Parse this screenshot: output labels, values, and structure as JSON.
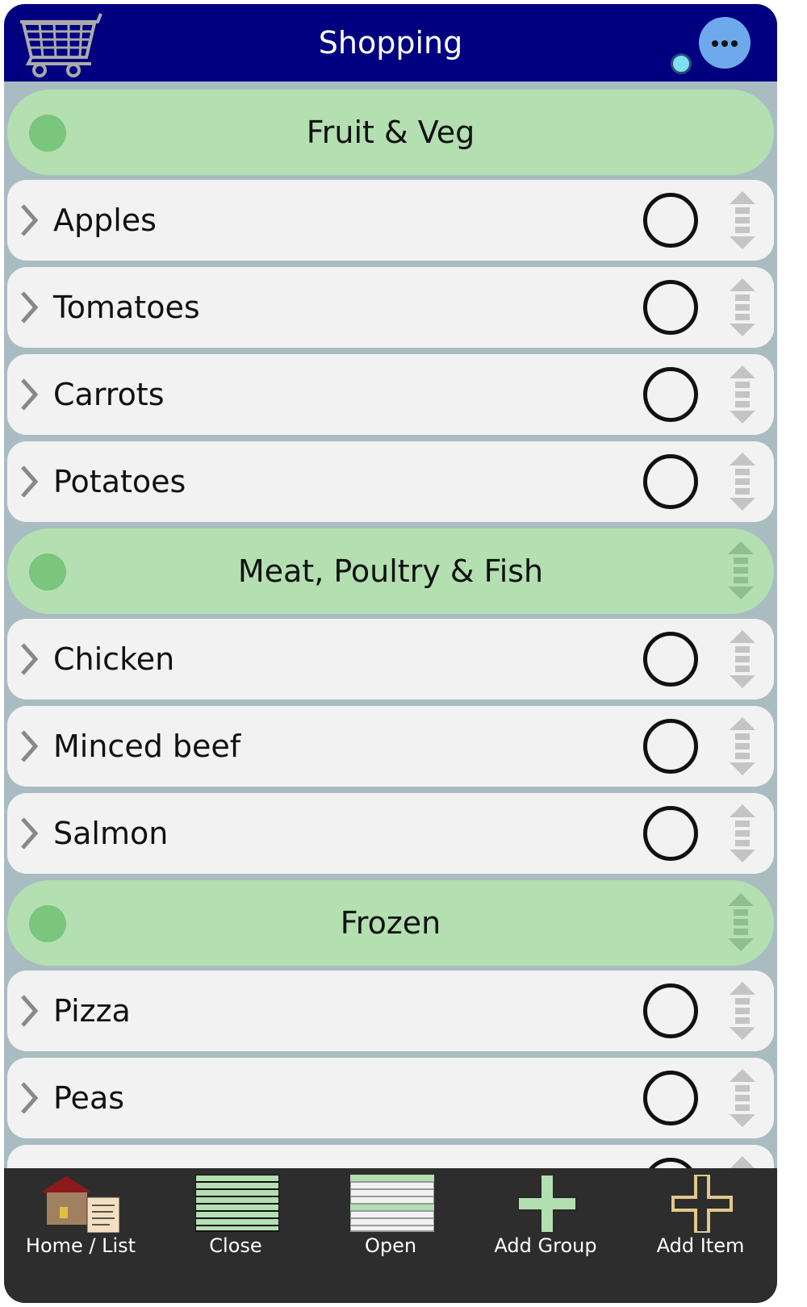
{
  "header": {
    "title": "Shopping",
    "menu_icon": "ellipsis-icon",
    "logo_icon": "shopping-cart-icon"
  },
  "groups": [
    {
      "label": "Fruit & Veg",
      "items": [
        "Apples",
        "Tomatoes",
        "Carrots",
        "Potatoes"
      ]
    },
    {
      "label": "Meat, Poultry & Fish",
      "items": [
        "Chicken",
        "Minced beef",
        "Salmon"
      ]
    },
    {
      "label": "Frozen",
      "items": [
        "Pizza",
        "Peas"
      ]
    }
  ],
  "toolbar": {
    "home_label": "Home / List",
    "close_label": "Close",
    "open_label": "Open",
    "add_group_label": "Add Group",
    "add_item_label": "Add Item"
  },
  "colors": {
    "header_bg": "#000080",
    "group_bg": "#b3dfb1",
    "item_bg": "#f2f2f2",
    "toolbar_bg": "#2d2d2d",
    "menu_button": "#6ea9ec"
  }
}
